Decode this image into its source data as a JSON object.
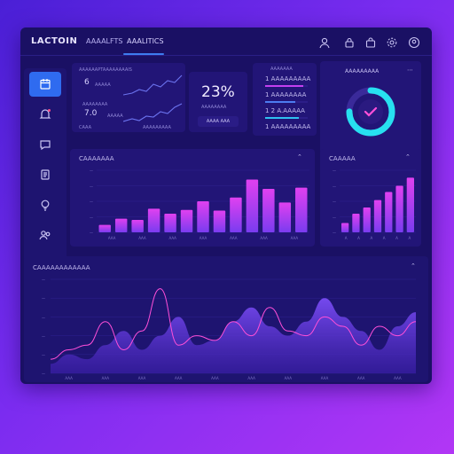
{
  "header": {
    "brand": "LACTOIN",
    "tabs": [
      {
        "label": "AAAALFTS"
      },
      {
        "label": "AAALITICS"
      }
    ]
  },
  "stats": {
    "title": "AAAAAAPTAAAAAAAAIS",
    "row1_value": "6",
    "row1_caption": "AAAAA",
    "row2_label": "AAAAAAAA",
    "row2_value": "7.0",
    "row2_caption": "AAAAA",
    "footer_left": "CAAA",
    "footer_right": "AAAAAAAAA"
  },
  "kpi": {
    "value": "23%",
    "caption": "AAAAAAAA",
    "button": "AAAA AAA"
  },
  "ledger": {
    "title": "AAAAAAA",
    "rows": [
      "1 AAAAAAAAA",
      "1 AAAAAAAA",
      "1 2 A.AAAAA",
      "1 AAAAAAAAA"
    ],
    "bar_fill": [
      0.9,
      0.7,
      0.8,
      0.6
    ]
  },
  "donut": {
    "title": "AAAAAAAAA",
    "fraction": 0.75
  },
  "colors": {
    "accent_blue": "#2f6bf0",
    "bar_top": "#e040f0",
    "bar_bottom": "#7a3cf0",
    "line_pink": "#ff4fd8",
    "area_purple": "#6a3ef0",
    "donut_cyan": "#27e0f0"
  },
  "chart_data": [
    {
      "type": "bar",
      "title": "CAAAAAAA",
      "categories": [
        "",
        "",
        "",
        "",
        "",
        "",
        "",
        "",
        "",
        "",
        "",
        "",
        ""
      ],
      "values": [
        12,
        22,
        20,
        38,
        30,
        36,
        50,
        35,
        56,
        85,
        70,
        48,
        72
      ],
      "ylim": [
        0,
        100
      ],
      "xticks": [
        "AAA",
        "AAA",
        "AAA",
        "AAA",
        "AAA",
        "AAA",
        "AAA"
      ]
    },
    {
      "type": "bar",
      "title": "CAAAAA",
      "categories": [
        "",
        "",
        "",
        "",
        "",
        "",
        ""
      ],
      "values": [
        15,
        30,
        40,
        52,
        65,
        75,
        88
      ],
      "ylim": [
        0,
        100
      ],
      "xticks": [
        "A",
        "A",
        "A",
        "A",
        "A",
        "A"
      ]
    },
    {
      "type": "area",
      "title": "CAAAAAAAAAAAA",
      "x": [
        0,
        1,
        2,
        3,
        4,
        5,
        6,
        7,
        8,
        9,
        10,
        11,
        12,
        13,
        14,
        15,
        16,
        17,
        18,
        19,
        20
      ],
      "series": [
        {
          "values": [
            10,
            20,
            15,
            30,
            45,
            25,
            40,
            60,
            30,
            35,
            55,
            70,
            50,
            40,
            55,
            80,
            60,
            45,
            25,
            50,
            65
          ]
        },
        {
          "values": [
            15,
            25,
            30,
            55,
            25,
            45,
            90,
            30,
            40,
            35,
            55,
            40,
            70,
            45,
            40,
            60,
            50,
            30,
            50,
            40,
            55
          ]
        }
      ],
      "ylim": [
        0,
        100
      ],
      "xticks": [
        "AAA",
        "AAA",
        "AAA",
        "AAA",
        "AAA",
        "AAA",
        "AAA",
        "AAA",
        "AAA",
        "AAA"
      ]
    }
  ]
}
